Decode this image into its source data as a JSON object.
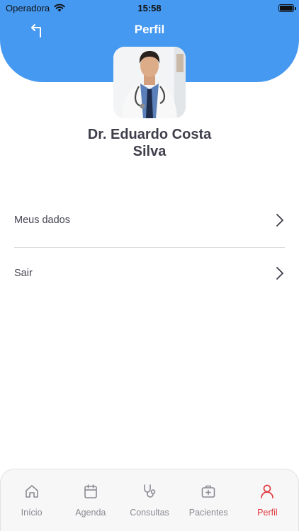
{
  "status_bar": {
    "carrier": "Operadora",
    "time": "15:58"
  },
  "header": {
    "title": "Perfil",
    "back_icon": "back-arrow-icon"
  },
  "profile": {
    "name_line1": "Dr. Eduardo Costa",
    "name_line2": "Silva"
  },
  "menu": [
    {
      "label": "Meus dados",
      "icon": "chevron-right-icon"
    },
    {
      "label": "Sair",
      "icon": "chevron-right-icon"
    }
  ],
  "tabs": [
    {
      "label": "Início",
      "icon": "home-icon",
      "active": false
    },
    {
      "label": "Agenda",
      "icon": "calendar-icon",
      "active": false
    },
    {
      "label": "Consultas",
      "icon": "stethoscope-icon",
      "active": false
    },
    {
      "label": "Pacientes",
      "icon": "medical-bag-icon",
      "active": false
    },
    {
      "label": "Perfil",
      "icon": "user-icon",
      "active": true
    }
  ],
  "colors": {
    "header": "#4699f0",
    "active_tab": "#e0383d",
    "inactive_tab": "#8a8a92"
  }
}
